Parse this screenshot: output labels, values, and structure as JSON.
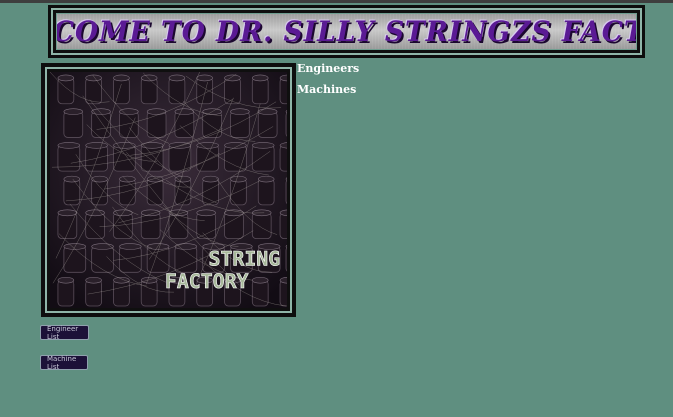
{
  "banner": {
    "title": "WELCOME TO DR. SILLY STRINGZS FACTORY"
  },
  "image": {
    "overlay_line1": "STRING",
    "overlay_line2": "FACTORY"
  },
  "links": [
    {
      "label": "Engineers"
    },
    {
      "label": "Machines"
    }
  ],
  "buttons": {
    "engineer_list": "Engineer List",
    "machine_list": "Machine List"
  },
  "colors": {
    "background": "#5f8f80",
    "banner_text": "#5a1a94",
    "button_bg": "#1c1138",
    "frame_border": "#8fb5a8"
  }
}
